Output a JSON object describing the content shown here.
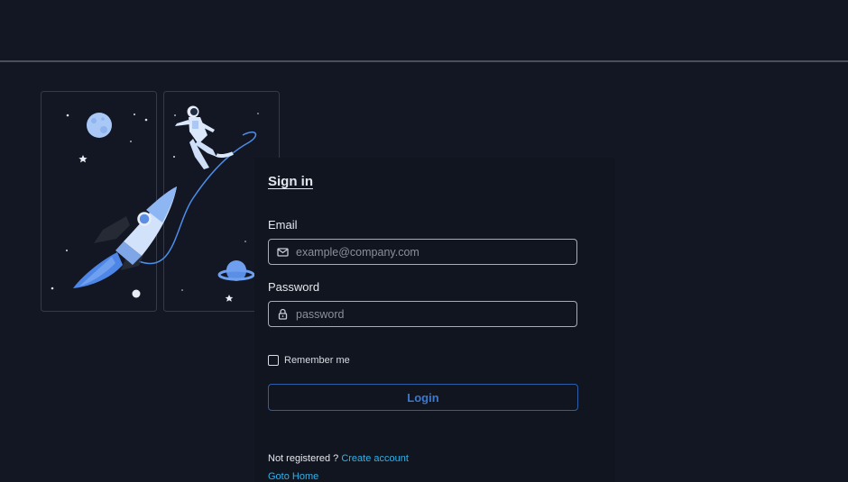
{
  "signin": {
    "title": "Sign in",
    "email_label": "Email",
    "email_placeholder": "example@company.com",
    "password_label": "Password",
    "password_placeholder": "password",
    "remember_label": "Remember me",
    "login_label": "Login",
    "not_registered": "Not registered ?",
    "create_account": "Create account",
    "goto_home": "Goto Home"
  },
  "icons": {
    "email": "envelope-icon",
    "password": "lock-icon"
  },
  "colors": {
    "background": "#121723",
    "accent": "#3d78cf",
    "link": "#2fb2e8",
    "illustration_blue": "#5b8fe6"
  }
}
